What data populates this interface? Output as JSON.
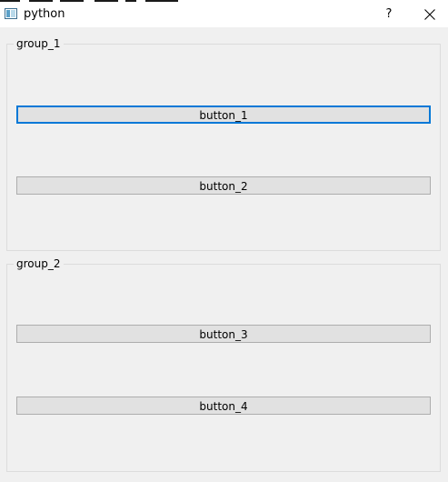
{
  "window": {
    "title": "python",
    "help_label": "?"
  },
  "groups": [
    {
      "title": "group_1",
      "buttons": [
        {
          "label": "button_1",
          "focused": true
        },
        {
          "label": "button_2",
          "focused": false
        }
      ]
    },
    {
      "title": "group_2",
      "buttons": [
        {
          "label": "button_3",
          "focused": false
        },
        {
          "label": "button_4",
          "focused": false
        }
      ]
    }
  ],
  "colors": {
    "window_bg": "#f0f0f0",
    "titlebar_bg": "#ffffff",
    "button_bg": "#e1e1e1",
    "button_border": "#adadad",
    "focus_border": "#0078d7",
    "group_border": "#dcdcdc"
  },
  "icons": {
    "app": "app-window-icon",
    "close": "close-icon"
  }
}
